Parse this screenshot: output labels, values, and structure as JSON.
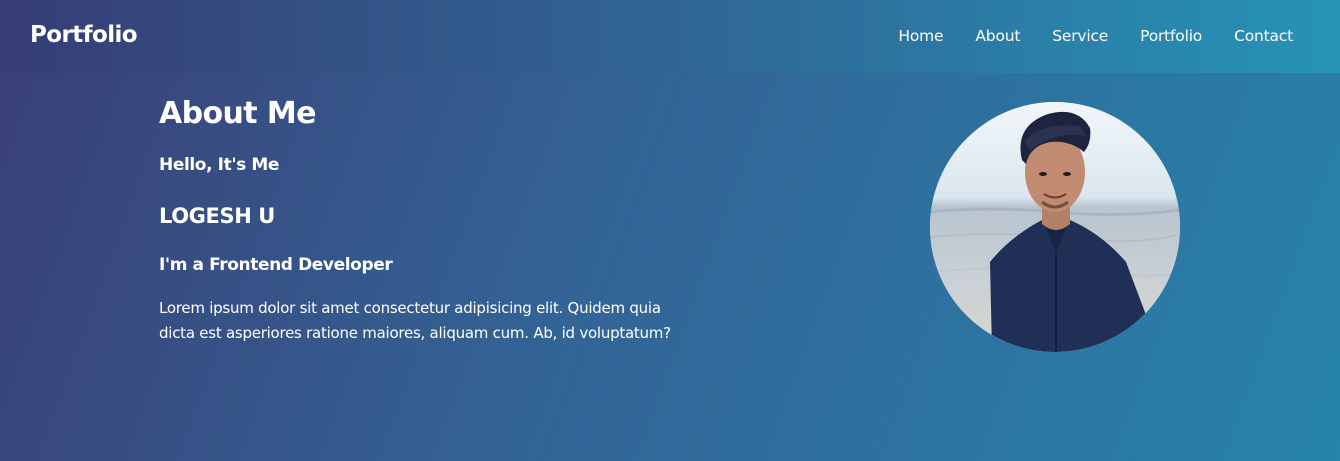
{
  "header": {
    "brand": "Portfolio",
    "nav": [
      {
        "label": "Home"
      },
      {
        "label": "About"
      },
      {
        "label": "Service"
      },
      {
        "label": "Portfolio"
      },
      {
        "label": "Contact"
      }
    ]
  },
  "about": {
    "title": "About Me",
    "greeting": "Hello, It's Me",
    "name": "LOGESH U",
    "role": "I'm a Frontend Developer",
    "description": "Lorem ipsum dolor sit amet consectetur adipisicing elit. Quidem quia dicta est asperiores ratione maiores, aliquam cum. Ab, id voluptatum?"
  },
  "colors": {
    "background_start": "#3a3e77",
    "background_end": "#2683ab",
    "text": "#ffffff"
  },
  "icons": {
    "profile_photo": "profile-photo"
  }
}
